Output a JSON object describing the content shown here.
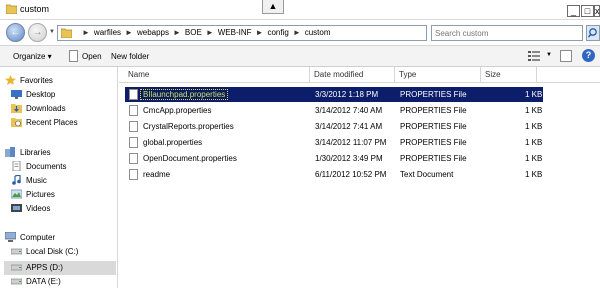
{
  "window": {
    "title": "custom",
    "collapse_glyph": "▲",
    "minimize_glyph": "_",
    "maximize_glyph": "□",
    "close_glyph": "x"
  },
  "address": {
    "back_glyph": "←",
    "forward_glyph": "→",
    "dropdown_glyph": "▼",
    "breadcrumb": [
      "warfiles",
      "webapps",
      "BOE",
      "WEB-INF",
      "config",
      "custom"
    ],
    "separator": "►",
    "refresh_glyph": "↻"
  },
  "search": {
    "placeholder": "Search custom"
  },
  "toolbar": {
    "organize_label": "Organize ▾",
    "open_label": "Open",
    "new_folder_label": "New folder",
    "views_dropdown_glyph": "▼",
    "help_glyph": "?"
  },
  "nav": {
    "favorites_label": "Favorites",
    "desktop_label": "Desktop",
    "downloads_label": "Downloads",
    "recent_label": "Recent Places",
    "libraries_label": "Libraries",
    "documents_label": "Documents",
    "music_label": "Music",
    "pictures_label": "Pictures",
    "videos_label": "Videos",
    "computer_label": "Computer",
    "local_disk_label": "Local Disk (C:)",
    "apps_label": "APPS (D:)",
    "data_label": "DATA (E:)"
  },
  "columns": {
    "name": "Name",
    "date": "Date modified",
    "type": "Type",
    "size": "Size",
    "sort_glyph": "▲"
  },
  "files": [
    {
      "name": "BIlaunchpad.properties",
      "date": "3/3/2012 1:18 PM",
      "type": "PROPERTIES File",
      "size": "1 KB"
    },
    {
      "name": "CmcApp.properties",
      "date": "3/14/2012 7:40 AM",
      "type": "PROPERTIES File",
      "size": "1 KB"
    },
    {
      "name": "CrystalReports.properties",
      "date": "3/14/2012 7:41 AM",
      "type": "PROPERTIES File",
      "size": "1 KB"
    },
    {
      "name": "global.properties",
      "date": "3/14/2012 11:07 PM",
      "type": "PROPERTIES File",
      "size": "1 KB"
    },
    {
      "name": "OpenDocument.properties",
      "date": "1/30/2012 3:49 PM",
      "type": "PROPERTIES File",
      "size": "1 KB"
    },
    {
      "name": "readme",
      "date": "6/11/2012 10:52 PM",
      "type": "Text Document",
      "size": "1 KB"
    }
  ],
  "colors": {
    "selection_bg": "#0c1e6a",
    "selected_text": "#c9e36b",
    "folder_yellow": "#e8c456",
    "toolbar_bg": "#f3f3f3"
  }
}
